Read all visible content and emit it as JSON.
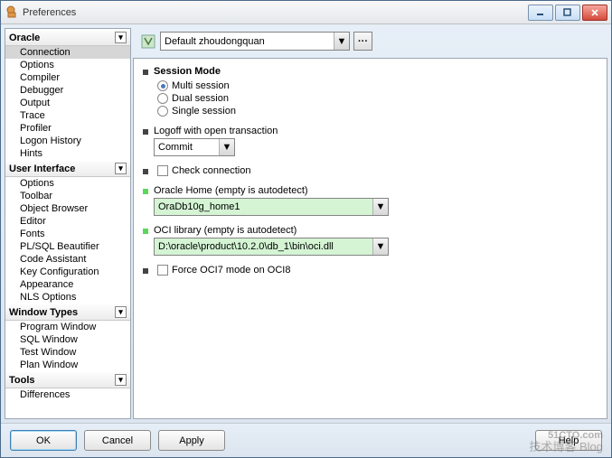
{
  "title": "Preferences",
  "profile": "Default zhoudongquan",
  "sidebar": {
    "oracle": {
      "label": "Oracle",
      "items": [
        "Connection",
        "Options",
        "Compiler",
        "Debugger",
        "Output",
        "Trace",
        "Profiler",
        "Logon History",
        "Hints"
      ]
    },
    "ui": {
      "label": "User Interface",
      "items": [
        "Options",
        "Toolbar",
        "Object Browser",
        "Editor",
        "Fonts",
        "PL/SQL Beautifier",
        "Code Assistant",
        "Key Configuration",
        "Appearance",
        "NLS Options"
      ]
    },
    "wt": {
      "label": "Window Types",
      "items": [
        "Program Window",
        "SQL Window",
        "Test Window",
        "Plan Window"
      ]
    },
    "tools": {
      "label": "Tools",
      "items": [
        "Differences"
      ]
    }
  },
  "sessionMode": {
    "title": "Session Mode",
    "multi": "Multi session",
    "dual": "Dual session",
    "single": "Single session"
  },
  "logoff": {
    "label": "Logoff with open transaction",
    "value": "Commit"
  },
  "checkConn": "Check connection",
  "oracleHome": {
    "label": "Oracle Home (empty is autodetect)",
    "value": "OraDb10g_home1"
  },
  "ociLib": {
    "label": "OCI library (empty is autodetect)",
    "value": "D:\\oracle\\product\\10.2.0\\db_1\\bin\\oci.dll"
  },
  "forceOci7": "Force OCI7 mode on OCI8",
  "buttons": {
    "ok": "OK",
    "cancel": "Cancel",
    "apply": "Apply",
    "help": "Help"
  },
  "watermark": {
    "main": "51CTO.com",
    "sub": "技术博客  Blog"
  }
}
